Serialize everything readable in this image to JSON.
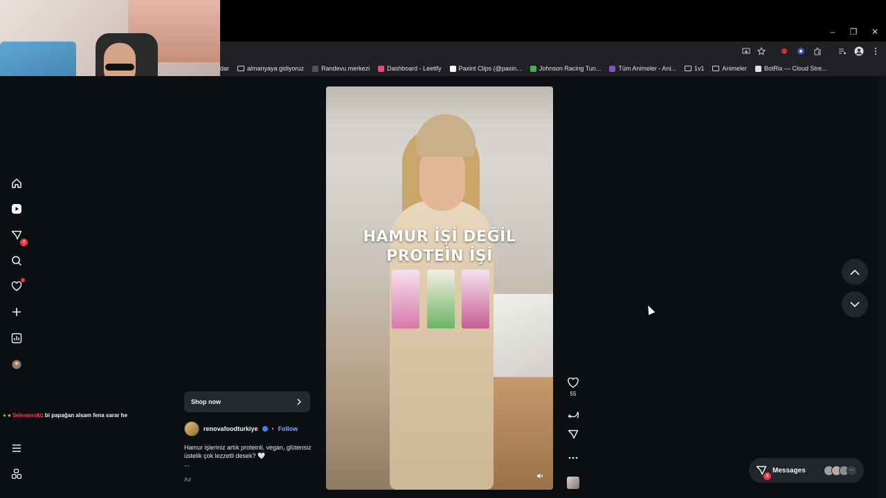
{
  "window_controls": {
    "minimize": "–",
    "restore": "❐",
    "close": "✕"
  },
  "bookmarks": [
    {
      "label": "dar",
      "icon": "none",
      "color": ""
    },
    {
      "label": "almanyaya gidiyoruz",
      "icon": "folder-icon",
      "color": ""
    },
    {
      "label": "Randevu merkezi",
      "icon": "site-icon",
      "color": "#555555"
    },
    {
      "label": "Dashboard - Leetify",
      "icon": "site-icon",
      "color": "#e84a7a"
    },
    {
      "label": "Paxint Clips (@paxin...",
      "icon": "tiktok-icon",
      "color": "#ffffff"
    },
    {
      "label": "Johnson Racing Tun...",
      "icon": "site-icon",
      "color": "#4caf50"
    },
    {
      "label": "Tüm Animeler - Ani...",
      "icon": "site-icon",
      "color": "#7e57c2"
    },
    {
      "label": "1v1",
      "icon": "folder-icon",
      "color": ""
    },
    {
      "label": "Animeler",
      "icon": "folder-icon",
      "color": ""
    },
    {
      "label": "BotRix — Cloud Stre...",
      "icon": "site-icon",
      "color": "#e0e0e0"
    }
  ],
  "nav": {
    "direct_badge": "4"
  },
  "chat": {
    "user": "Selenovski",
    "message": ": bi papağan alsam fena sarar he",
    "user_color": "#ff3b5c"
  },
  "reel": {
    "caption_line1": "HAMUR İŞİ DEĞİL",
    "caption_line2": "PROTEİN İŞİ"
  },
  "post": {
    "shop_label": "Shop now",
    "username": "renovafoodturkiye",
    "separator": "•",
    "follow_label": "Follow",
    "description": "Hamur işleriniz artık proteinli, vegan, glütensiz üstelik çok lezzetli desek? 🤍",
    "ellipsis": "...",
    "ad_label": "Ad",
    "likes": "55"
  },
  "messages": {
    "label": "Messages",
    "badge": "4"
  }
}
